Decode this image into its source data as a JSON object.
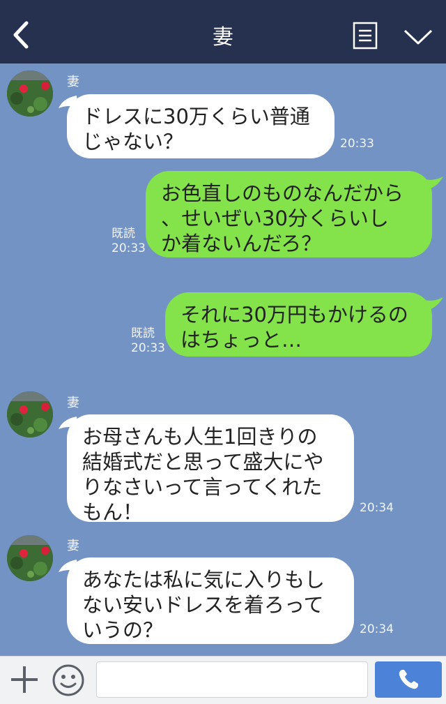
{
  "header": {
    "title": "妻",
    "back_icon": "chevron-left-icon",
    "menu_icon": "memo-icon",
    "expand_icon": "chevron-down-icon",
    "background": "#263150"
  },
  "chat": {
    "background": "#7293c4",
    "messages": [
      {
        "direction": "incoming",
        "sender": "妻",
        "text": "ドレスに30万くらい普通\nじゃない？",
        "time": "20:33"
      },
      {
        "direction": "outgoing",
        "text": "お色直しのものなんだから\n、せいぜい30分くらいし\nか着ないんだろ？",
        "read": "既読",
        "time": "20:33"
      },
      {
        "direction": "outgoing",
        "text": "それに30万円もかけるの\nはちょっと…",
        "read": "既読",
        "time": "20:33"
      },
      {
        "direction": "incoming",
        "sender": "妻",
        "text": "お母さんも人生1回きりの\n結婚式だと思って盛大にや\nりなさいって言ってくれた\nもん！",
        "time": "20:34"
      },
      {
        "direction": "incoming",
        "sender": "妻",
        "text": "あなたは私に気に入りもし\nない安いドレスを着ろって\nいうの？",
        "time": "20:34"
      }
    ],
    "bubble_colors": {
      "incoming": "#ffffff",
      "outgoing": "#84e34a"
    }
  },
  "composer": {
    "plus_icon": "plus-icon",
    "emoji_icon": "smiley-icon",
    "input_value": "",
    "call_icon": "phone-icon",
    "call_color": "#4d82d9"
  }
}
